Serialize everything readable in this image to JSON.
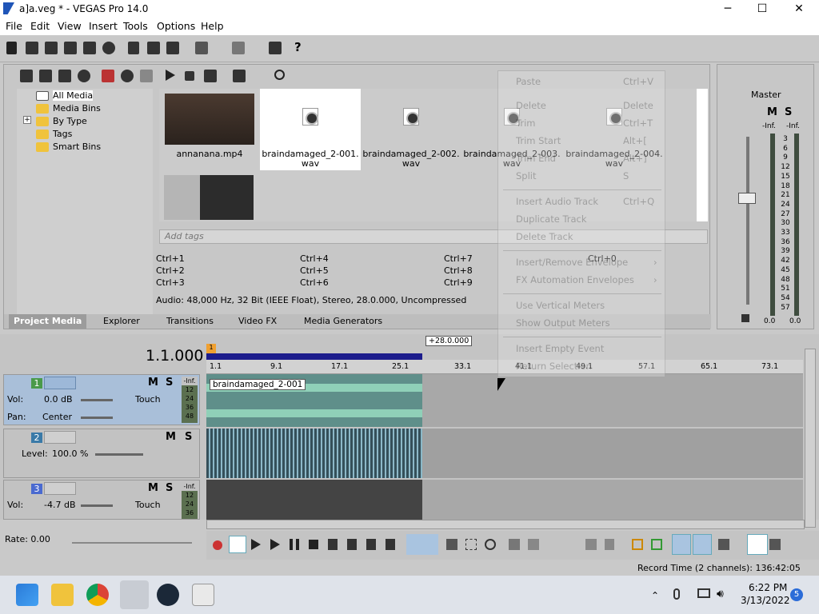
{
  "window": {
    "title": "a]a.veg * - VEGAS Pro 14.0",
    "min": "─",
    "max": "☐",
    "close": "✕"
  },
  "menu": [
    "File",
    "Edit",
    "View",
    "Insert",
    "Tools",
    "Options",
    "Help"
  ],
  "tree": {
    "items": [
      "All Media",
      "Media Bins",
      "By Type",
      "Tags",
      "Smart Bins"
    ],
    "expand": "+"
  },
  "media": {
    "items": [
      "annanana.mp4",
      "braindamaged_2-001.wav",
      "braindamaged_2-002.wav",
      "braindamaged_2-003.wav",
      "braindamaged_2-004.wav"
    ]
  },
  "tags_placeholder": "Add tags",
  "shortcuts": [
    "Ctrl+1",
    "Ctrl+2",
    "Ctrl+3",
    "Ctrl+4",
    "Ctrl+5",
    "Ctrl+6",
    "Ctrl+7",
    "Ctrl+8",
    "Ctrl+9",
    "Ctrl+0"
  ],
  "audio_info": "Audio: 48,000 Hz, 32 Bit (IEEE Float), Stereo, 28.0.000, Uncompressed",
  "panel_tabs": [
    "Project Media",
    "Explorer",
    "Transitions",
    "Video FX",
    "Media Generators"
  ],
  "master": {
    "label": "Master",
    "m": "M",
    "s": "S",
    "inf_l": "-Inf.",
    "inf_r": "-Inf.",
    "scale": [
      "3",
      "6",
      "9",
      "12",
      "15",
      "18",
      "21",
      "24",
      "27",
      "30",
      "33",
      "36",
      "39",
      "42",
      "45",
      "48",
      "51",
      "54",
      "57"
    ],
    "bottom_l": "0.0",
    "bottom_r": "0.0"
  },
  "timeline": {
    "time": "1.1.000",
    "marker": "+28.0.000",
    "ruler": [
      "1.1",
      "9.1",
      "17.1",
      "25.1",
      "33.1",
      "41.1",
      "49.1",
      "57.1",
      "65.1",
      "73.1"
    ],
    "clip_label": "braindamaged_2-001",
    "loop_flag": "1"
  },
  "tracks": [
    {
      "num": "1",
      "vol_label": "Vol:",
      "vol": "0.0 dB",
      "pan_label": "Pan:",
      "pan": "Center",
      "touch": "Touch",
      "m": "M",
      "s": "S",
      "meter": [
        "-Inf.",
        "12",
        "24",
        "36",
        "48"
      ]
    },
    {
      "num": "2",
      "level_label": "Level:",
      "level": "100.0 %",
      "m": "M",
      "s": "S"
    },
    {
      "num": "3",
      "vol_label": "Vol:",
      "vol": "-4.7 dB",
      "touch": "Touch",
      "m": "M",
      "s": "S",
      "meter": [
        "-Inf.",
        "12",
        "24",
        "36"
      ]
    }
  ],
  "rate": "Rate: 0.00",
  "status_text": "Record Time (2 channels): 136:42:05",
  "context_menu": [
    {
      "label": "Paste",
      "key": "Ctrl+V"
    },
    {
      "label": "Delete",
      "key": "Delete"
    },
    {
      "label": "Trim",
      "key": "Ctrl+T"
    },
    {
      "label": "Trim Start",
      "key": "Alt+["
    },
    {
      "label": "Trim End",
      "key": "Alt+]"
    },
    {
      "label": "Split",
      "key": "S"
    },
    {
      "label": "Insert Audio Track",
      "key": "Ctrl+Q"
    },
    {
      "label": "Duplicate Track",
      "key": ""
    },
    {
      "label": "Delete Track",
      "key": ""
    },
    {
      "label": "Insert/Remove Envelope",
      "key": "›"
    },
    {
      "label": "FX Automation Envelopes",
      "key": "›"
    },
    {
      "label": "Use Vertical Meters",
      "key": ""
    },
    {
      "label": "Show Output Meters",
      "key": ""
    },
    {
      "label": "Insert Empty Event",
      "key": ""
    },
    {
      "label": "Return Selection",
      "key": ""
    }
  ],
  "clock": {
    "time": "6:22 PM",
    "date": "3/13/2022",
    "badge": "5"
  },
  "colors": {
    "accent": "#1f55b8",
    "selection": "#a9bfd9",
    "audio_wave": "#8fd0b8",
    "waveform_dark": "#35505a"
  }
}
